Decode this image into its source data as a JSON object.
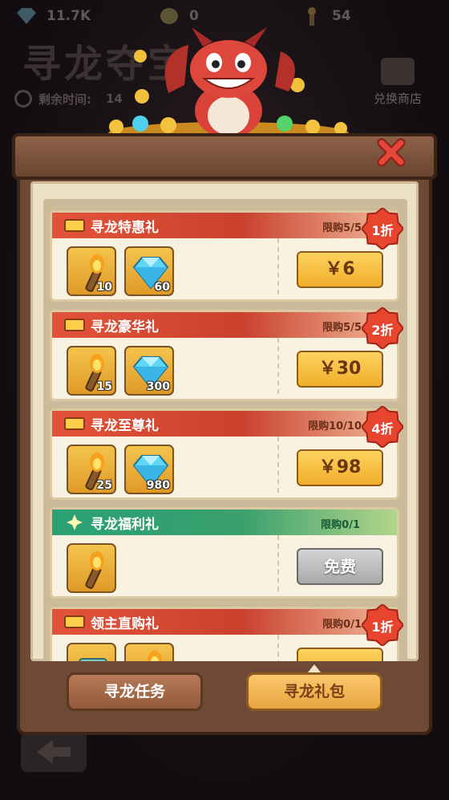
{
  "background": {
    "resources": [
      {
        "icon": "diamond-icon",
        "value": "11.7K"
      },
      {
        "icon": "coin-icon",
        "value": "0"
      },
      {
        "icon": "torch-icon",
        "value": "54"
      }
    ],
    "event_title": "寻龙夺宝",
    "timer_label": "剩余时间:",
    "timer_value": "14",
    "shop_label": "兑换商店"
  },
  "gifts": [
    {
      "title": "寻龙特惠礼",
      "limit": "限购5/5",
      "discount": "1折",
      "items": [
        {
          "icon": "torch-icon",
          "qty": "10"
        },
        {
          "icon": "diamond-icon",
          "qty": "60"
        }
      ],
      "price": "￥6",
      "style": "red"
    },
    {
      "title": "寻龙豪华礼",
      "limit": "限购5/5",
      "discount": "2折",
      "items": [
        {
          "icon": "torch-icon",
          "qty": "15"
        },
        {
          "icon": "diamond-icon",
          "qty": "300"
        }
      ],
      "price": "￥30",
      "style": "red"
    },
    {
      "title": "寻龙至尊礼",
      "limit": "限购10/10",
      "discount": "4折",
      "items": [
        {
          "icon": "torch-icon",
          "qty": "25"
        },
        {
          "icon": "diamond-icon",
          "qty": "980"
        }
      ],
      "price": "￥98",
      "style": "red"
    },
    {
      "title": "寻龙福利礼",
      "limit": "限购0/1",
      "discount": "",
      "items": [
        {
          "icon": "torch-icon",
          "qty": ""
        }
      ],
      "price": "免费",
      "style": "green"
    },
    {
      "title": "领主直购礼",
      "limit": "限购0/1",
      "discount": "1折",
      "items": [
        {
          "icon": "scroll-icon",
          "qty": ""
        },
        {
          "icon": "torch-icon",
          "qty": ""
        }
      ],
      "price": "",
      "style": "red"
    }
  ],
  "tabs": {
    "task": "寻龙任务",
    "gift": "寻龙礼包"
  },
  "colors": {
    "band_red": "#d8472f",
    "band_green": "#2aa176",
    "buy_gold": "#f5bd3a",
    "badge_red": "#e8452e"
  }
}
